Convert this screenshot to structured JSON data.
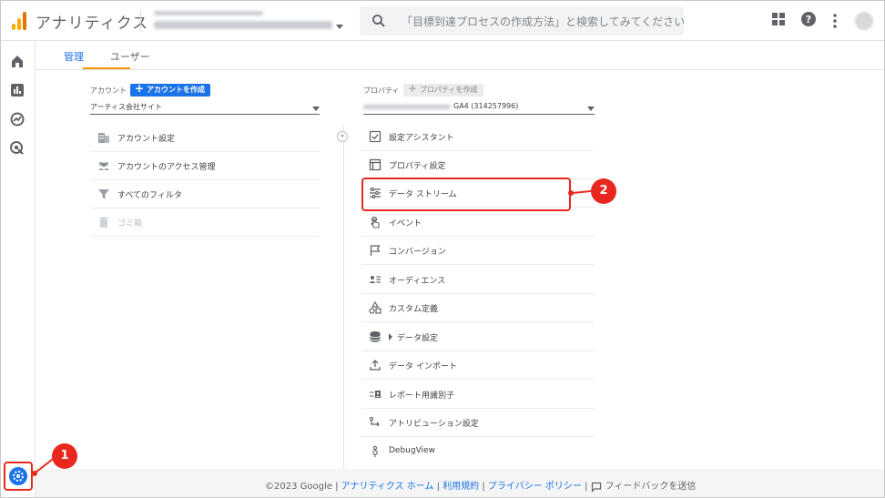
{
  "app": {
    "title": "アナリティクス"
  },
  "search": {
    "placeholder": "「目標到達プロセスの作成方法」と検索してみてください"
  },
  "tabs": [
    {
      "label": "管理",
      "active": true
    },
    {
      "label": "ユーザー",
      "active": false
    }
  ],
  "account": {
    "label": "アカウント",
    "create_label": "アカウントを作成",
    "selected": "アーティス会社サイト",
    "items": [
      {
        "label": "アカウント設定",
        "icon": "building-icon"
      },
      {
        "label": "アカウントのアクセス管理",
        "icon": "people-icon"
      },
      {
        "label": "すべてのフィルタ",
        "icon": "filter-icon"
      },
      {
        "label": "ゴミ箱",
        "icon": "trash-icon"
      }
    ]
  },
  "property": {
    "label": "プロパティ",
    "create_label": "プロパティを作成",
    "selected": "GA4 (314257996)",
    "items": [
      {
        "label": "設定アシスタント",
        "icon": "checklist-icon"
      },
      {
        "label": "プロパティ設定",
        "icon": "window-icon"
      },
      {
        "label": "データ ストリーム",
        "icon": "stream-icon"
      },
      {
        "label": "イベント",
        "icon": "touch-icon"
      },
      {
        "label": "コンバージョン",
        "icon": "flag-icon"
      },
      {
        "label": "オーディエンス",
        "icon": "audience-icon"
      },
      {
        "label": "カスタム定義",
        "icon": "shapes-icon"
      },
      {
        "label": "データ設定",
        "icon": "database-icon"
      },
      {
        "label": "データ インポート",
        "icon": "upload-icon"
      },
      {
        "label": "レポート用識別子",
        "icon": "identifier-icon"
      },
      {
        "label": "アトリビューション設定",
        "icon": "attribution-icon"
      },
      {
        "label": "DebugView",
        "icon": "debug-icon"
      }
    ]
  },
  "callouts": {
    "one": "1",
    "two": "2"
  },
  "footer": {
    "copyright": "©2023 Google",
    "sep": " | ",
    "link_home": "アナリティクス ホーム",
    "link_terms": "利用規約",
    "link_privacy": "プライバシー ポリシー",
    "feedback": "フィードバックを送信"
  },
  "colors": {
    "accent": "#1a73e8",
    "tab_underline": "#f29900",
    "callout": "#e8281e"
  }
}
